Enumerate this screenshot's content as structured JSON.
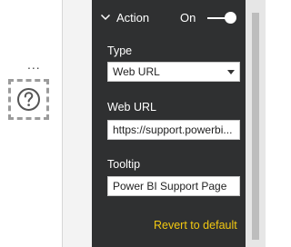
{
  "canvas": {
    "more_options_glyph": "...",
    "placeholder_icon": "question-mark-circle-icon"
  },
  "panel": {
    "section": {
      "title": "Action",
      "toggle_label": "On",
      "toggle_on": true
    },
    "type_field": {
      "label": "Type",
      "value": "Web URL"
    },
    "url_field": {
      "label": "Web URL",
      "value": "https://support.powerbi..."
    },
    "tooltip_field": {
      "label": "Tooltip",
      "value": "Power BI Support Page"
    },
    "revert_label": "Revert to default"
  },
  "colors": {
    "panel_bg": "#2f3031",
    "accent": "#f2c811",
    "text_on_dark": "#ffffff"
  }
}
